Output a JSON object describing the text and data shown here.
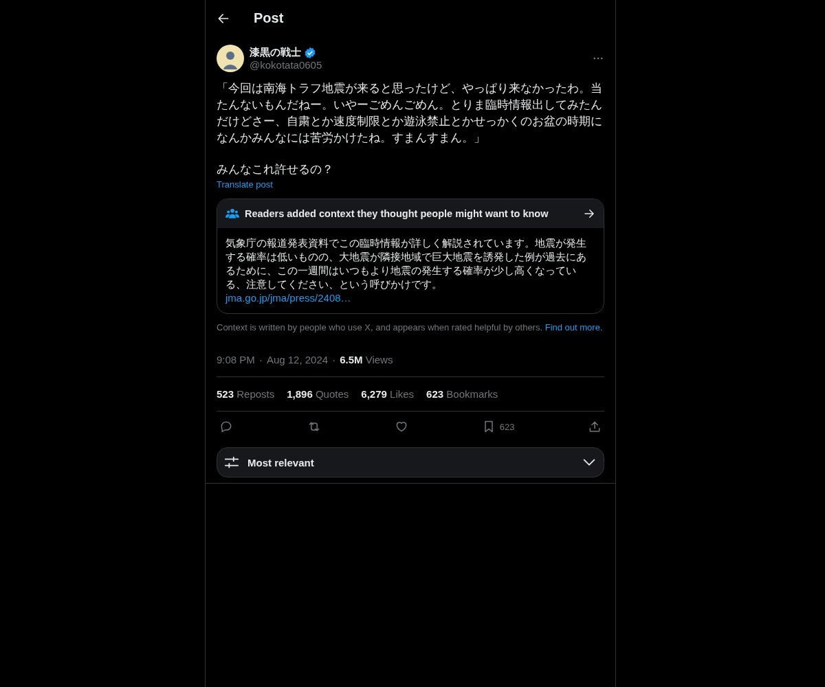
{
  "header": {
    "title": "Post"
  },
  "author": {
    "name": "漆黒の戦士",
    "verified": true,
    "handle": "@kokotata0605"
  },
  "post": {
    "paragraphs": [
      "「今回は南海トラフ地震が来ると思ったけど、やっぱり来なかったわ。当たんないもんだねー。いやーごめんごめん。とりま臨時情報出してみたんだけどさー、自粛とか速度制限とか遊泳禁止とかせっかくのお盆の時期になんかみんなには苦労かけたね。すまんすまん。」",
      "みんなこれ許せるの？"
    ],
    "translate": "Translate post"
  },
  "note": {
    "title": "Readers added context they thought people might want to know",
    "body": "気象庁の報道発表資料でこの臨時情報が詳しく解説されています。地震が発生する確率は低いものの、大地震が隣接地域で巨大地震を誘発した例が過去にあるために、この一週間はいつもより地震の発生する確率が少し高くなっている、注意してください、という呼びかけです。",
    "link": "jma.go.jp/jma/press/2408…",
    "footer": "Context is written by people who use X, and appears when rated helpful by others.",
    "footer_link": "Find out more."
  },
  "meta": {
    "time": "9:08 PM",
    "separator_1": "·",
    "date": "Aug 12, 2024",
    "separator_2": "·",
    "views_count": "6.5M",
    "views_label": "Views"
  },
  "stats": [
    {
      "count": "523",
      "label": "Reposts"
    },
    {
      "count": "1,896",
      "label": "Quotes"
    },
    {
      "count": "6,279",
      "label": "Likes"
    },
    {
      "count": "623",
      "label": "Bookmarks"
    }
  ],
  "actions": [
    {
      "kind": "reply"
    },
    {
      "kind": "repost"
    },
    {
      "kind": "like"
    },
    {
      "kind": "bookmark",
      "count": "623"
    },
    {
      "kind": "share"
    }
  ],
  "sort": {
    "label": "Most relevant"
  }
}
